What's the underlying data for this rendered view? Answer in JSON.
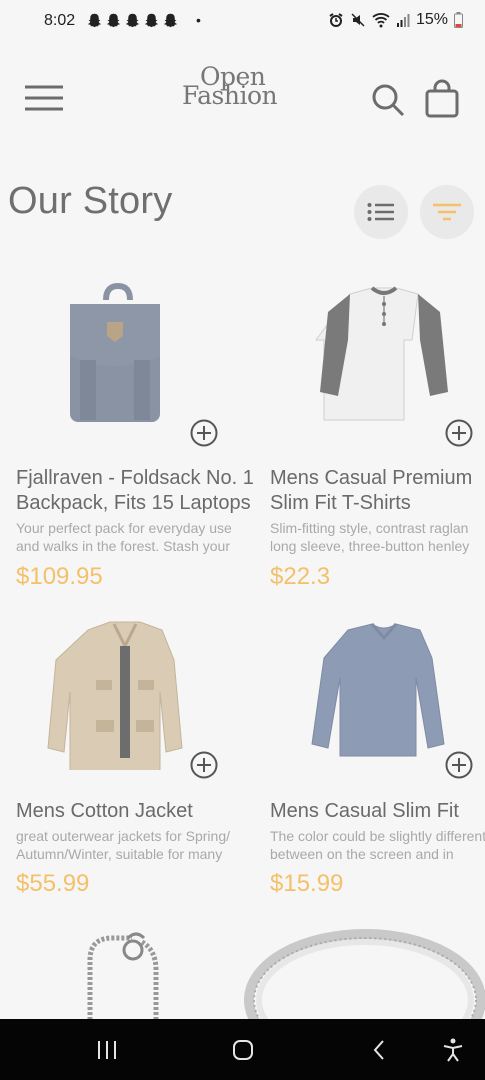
{
  "status_bar": {
    "time": "8:02",
    "dot": "•",
    "battery": "15%",
    "icons": [
      "snapchat-icon",
      "snapchat-icon",
      "snapchat-icon",
      "snapchat-icon",
      "snapchat-icon",
      "alarm-icon",
      "mute-icon",
      "wifi-icon",
      "signal-icon",
      "battery-icon"
    ]
  },
  "header": {
    "logo_line1": "Open",
    "logo_line2": "Fashion",
    "icons": [
      "menu-icon",
      "search-icon",
      "shopping-bag-icon"
    ]
  },
  "page": {
    "title": "Our Story",
    "view_icons": [
      "list-view-icon",
      "filter-icon"
    ],
    "accent": "#f4c069"
  },
  "products": [
    {
      "title_line1": "Fjallraven - Foldsack No. 1",
      "title_line2": "Backpack, Fits 15 Laptops",
      "desc_line1": "Your perfect pack for everyday use",
      "desc_line2": "and walks in the forest. Stash your",
      "price": "$109.95",
      "image": "backpack"
    },
    {
      "title_line1": "Mens Casual Premium",
      "title_line2": "Slim Fit T-Shirts",
      "desc_line1": "Slim-fitting style, contrast raglan",
      "desc_line2": "long sleeve, three-button henley",
      "price": "$22.3",
      "image": "henley-shirt"
    },
    {
      "title_line1": "Mens Cotton Jacket",
      "desc_line1": "great outerwear jackets for Spring/",
      "desc_line2": "Autumn/Winter, suitable for many",
      "price": "$55.99",
      "image": "cotton-jacket"
    },
    {
      "title_line1": "Mens Casual Slim Fit",
      "desc_line1": "The color could be slightly different",
      "desc_line2": "between on the screen and in",
      "price": "$15.99",
      "image": "long-sleeve-tee"
    },
    {
      "image": "bracelet"
    },
    {
      "image": "silver-ring"
    }
  ],
  "nav_bar": {
    "icons": [
      "recent-apps-icon",
      "home-icon",
      "back-icon",
      "accessibility-icon"
    ],
    "background": "#050505"
  }
}
